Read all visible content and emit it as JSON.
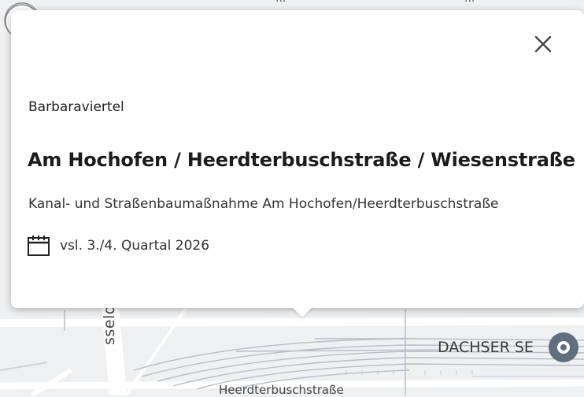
{
  "map": {
    "labels": {
      "street_vertical": "sseldorfer",
      "poi": "DACHSER SE",
      "street_bottom": "Heerdterbuschstraße",
      "top_partial_1": "···",
      "top_partial_2": "···"
    },
    "colors": {
      "road": "#ffffff",
      "rail": "#b9bec4",
      "background": "#eef0f2"
    }
  },
  "popup": {
    "close_icon": "close-icon",
    "district": "Barbaraviertel",
    "title": "Am Hochofen / Heerdterbuschstraße / Wiesenstraße",
    "description": "Kanal- und Straßenbaumaßnahme Am Hochofen/Heerdterbuschstraße",
    "date_icon": "calendar-icon",
    "date": "vsl. 3./4. Quartal 2026"
  },
  "marker": {
    "icon": "construction-cone-icon"
  },
  "poi_marker": {
    "icon": "location-pin-icon"
  }
}
